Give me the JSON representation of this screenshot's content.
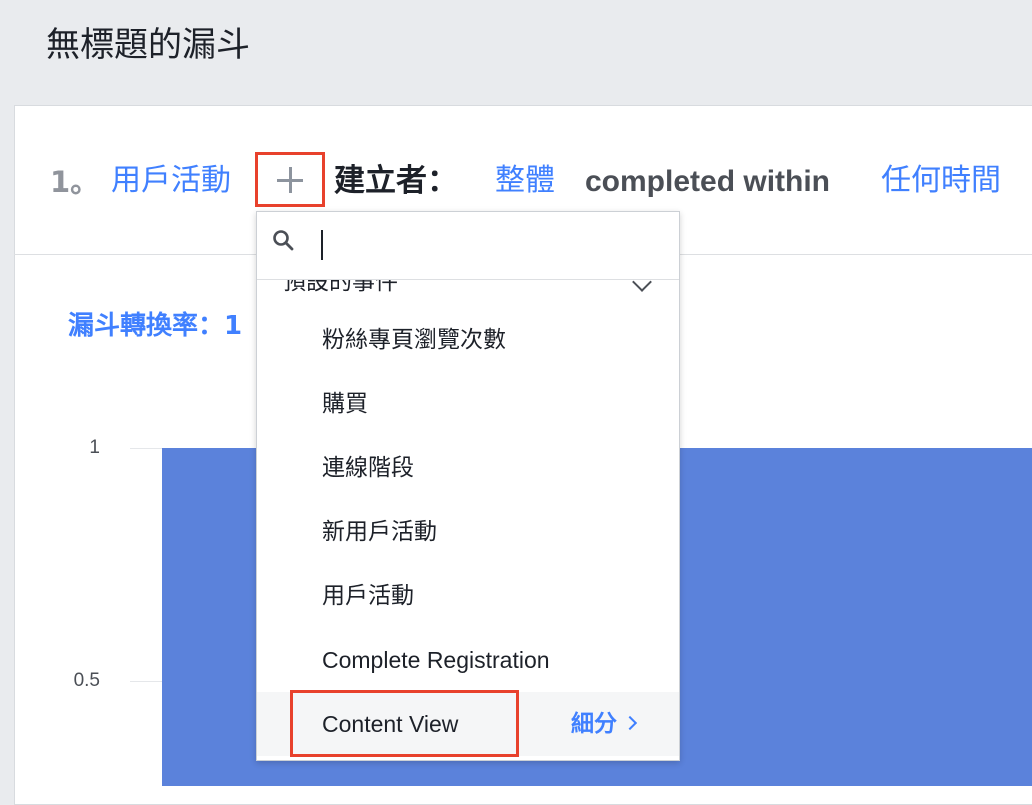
{
  "page": {
    "title": "無標題的漏斗"
  },
  "funnel_step": {
    "number": "1。",
    "event": "用戶活動",
    "created_by_label": "建立者：",
    "audience": "整體",
    "completed_within": "completed within",
    "time_window": "任何時間"
  },
  "chart": {
    "conversion_label": "漏斗轉換率：1",
    "ticks": [
      "1",
      "0.5"
    ]
  },
  "chart_data": {
    "type": "bar",
    "categories": [
      "用戶活動"
    ],
    "values": [
      1
    ],
    "ylim": [
      0,
      1
    ],
    "y_ticks": [
      1,
      0.5
    ],
    "grid": true,
    "color": "#5b82db"
  },
  "dropdown": {
    "search_placeholder": "",
    "group_header": "預設的事件",
    "items": [
      {
        "label": "粉絲專頁瀏覽次數"
      },
      {
        "label": "購買"
      },
      {
        "label": "連線階段"
      },
      {
        "label": "新用戶活動"
      },
      {
        "label": "用戶活動"
      },
      {
        "label": "Complete Registration"
      },
      {
        "label": "Content View"
      }
    ],
    "breakdown_label": "細分"
  },
  "colors": {
    "accent": "#4080ff",
    "bar": "#5b82db",
    "highlight": "#e8412c"
  }
}
